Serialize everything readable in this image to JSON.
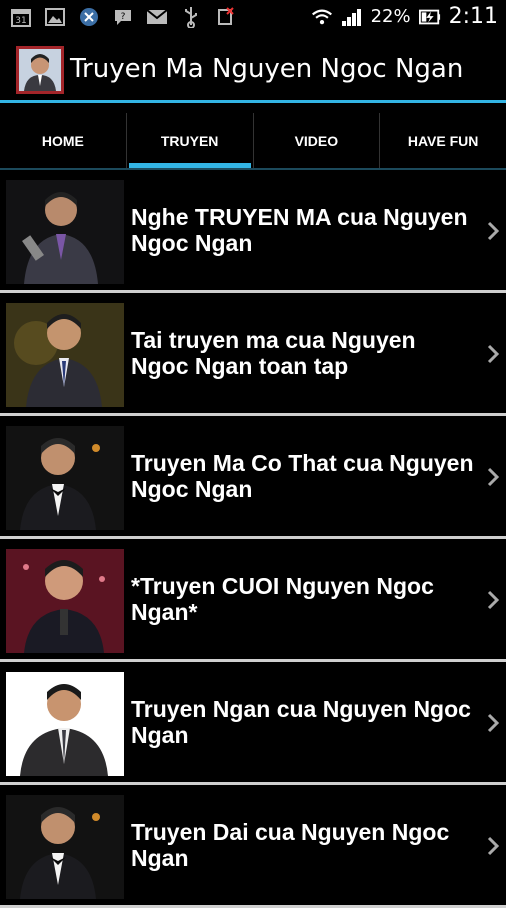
{
  "status": {
    "battery_pct": "22%",
    "time": "2:11"
  },
  "app": {
    "title": "Truyen Ma Nguyen Ngoc Ngan"
  },
  "tabs": [
    {
      "label": "HOME",
      "selected": false
    },
    {
      "label": "TRUYEN",
      "selected": true
    },
    {
      "label": "VIDEO",
      "selected": false
    },
    {
      "label": "HAVE FUN",
      "selected": false
    }
  ],
  "items": [
    {
      "title": "Nghe TRUYEN MA cua Nguyen Ngoc Ngan"
    },
    {
      "title": "Tai truyen ma cua Nguyen Ngoc Ngan toan tap"
    },
    {
      "title": "Truyen Ma Co That cua Nguyen Ngoc Ngan"
    },
    {
      "title": "*Truyen CUOI Nguyen Ngoc Ngan*"
    },
    {
      "title": "Truyen Ngan cua Nguyen Ngoc Ngan"
    },
    {
      "title": "Truyen Dai cua Nguyen Ngoc Ngan"
    }
  ],
  "colors": {
    "accent": "#33b5e5",
    "background": "#000000",
    "divider": "#cfcfcf"
  }
}
